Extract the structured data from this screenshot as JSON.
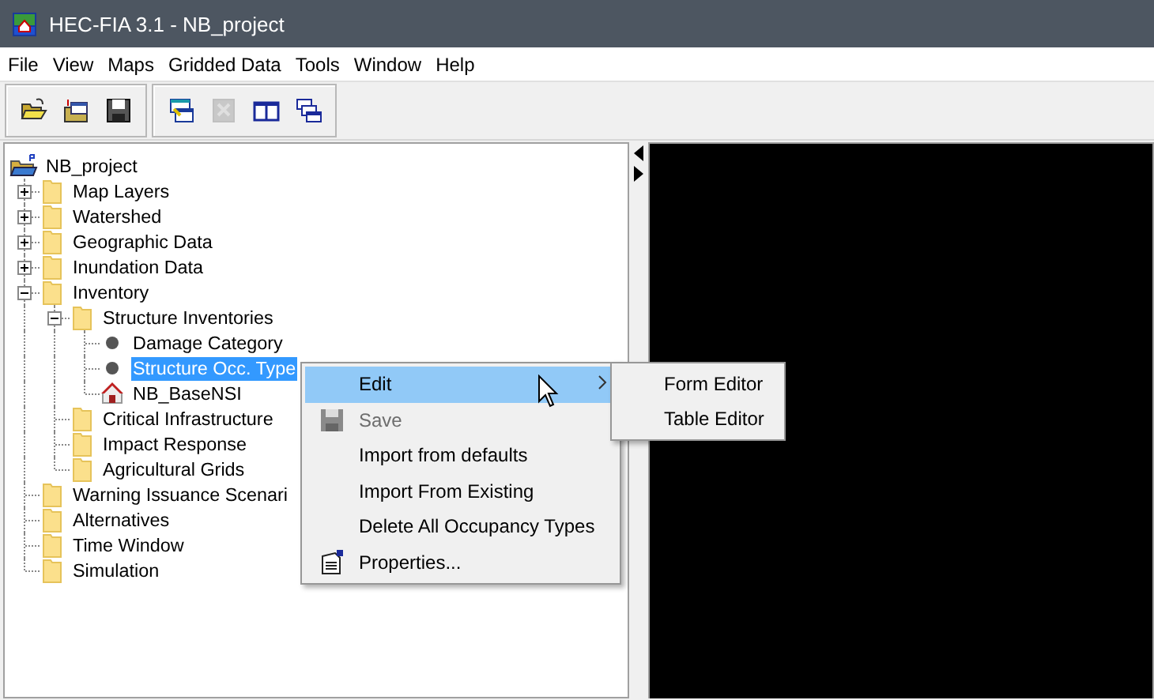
{
  "window": {
    "title": "HEC-FIA 3.1 - NB_project"
  },
  "menu_bar": [
    "File",
    "View",
    "Maps",
    "Gridded Data",
    "Tools",
    "Window",
    "Help"
  ],
  "toolbar": [
    [
      {
        "kind": "open",
        "disabled": false
      },
      {
        "kind": "import",
        "disabled": false
      },
      {
        "kind": "save",
        "disabled": false
      }
    ],
    [
      {
        "kind": "windows",
        "disabled": false
      },
      {
        "kind": "grid",
        "disabled": true
      },
      {
        "kind": "split",
        "disabled": false
      },
      {
        "kind": "cascade",
        "disabled": false
      }
    ]
  ],
  "tree": {
    "label": "NB_project",
    "kind": "project",
    "selected": false,
    "children": [
      {
        "label": "Map Layers",
        "kind": "folder",
        "selected": false,
        "expanded": false
      },
      {
        "label": "Watershed",
        "kind": "folder",
        "selected": false,
        "expanded": false
      },
      {
        "label": "Geographic Data",
        "kind": "folder",
        "selected": false,
        "expanded": false
      },
      {
        "label": "Inundation Data",
        "kind": "folder",
        "selected": false,
        "expanded": false
      },
      {
        "label": "Inventory",
        "kind": "folder",
        "selected": false,
        "expanded": true,
        "children": [
          {
            "label": "Structure Inventories",
            "kind": "folder",
            "selected": false,
            "expanded": true,
            "children": [
              {
                "label": "Damage Category",
                "kind": "dot",
                "selected": false
              },
              {
                "label": "Structure Occ. Type",
                "kind": "dot",
                "selected": true
              },
              {
                "label": "NB_BaseNSI",
                "kind": "structure",
                "selected": false
              }
            ]
          },
          {
            "label": "Critical Infrastructure",
            "kind": "folder",
            "selected": false
          },
          {
            "label": "Impact Response",
            "kind": "folder",
            "selected": false
          },
          {
            "label": "Agricultural Grids",
            "kind": "folder",
            "selected": false
          }
        ]
      },
      {
        "label": "Warning Issuance Scenari",
        "kind": "folder",
        "selected": false
      },
      {
        "label": "Alternatives",
        "kind": "folder",
        "selected": false
      },
      {
        "label": "Time Window",
        "kind": "folder",
        "selected": false
      },
      {
        "label": "Simulation",
        "kind": "folder",
        "selected": false
      }
    ]
  },
  "context_menu": {
    "items": [
      {
        "label": "Edit",
        "kind": "submenu",
        "highlighted": true,
        "disabled": false
      },
      {
        "label": "Save",
        "kind": "disk",
        "highlighted": false,
        "disabled": true
      },
      {
        "label": "Import from defaults",
        "kind": "text",
        "highlighted": false,
        "disabled": false
      },
      {
        "label": "Import From Existing",
        "kind": "text",
        "highlighted": false,
        "disabled": false
      },
      {
        "label": "Delete All Occupancy Types",
        "kind": "text",
        "highlighted": false,
        "disabled": false
      },
      {
        "label": "Properties...",
        "kind": "sheet",
        "highlighted": false,
        "disabled": false
      }
    ],
    "submenu": [
      "Form Editor",
      "Table Editor"
    ]
  }
}
